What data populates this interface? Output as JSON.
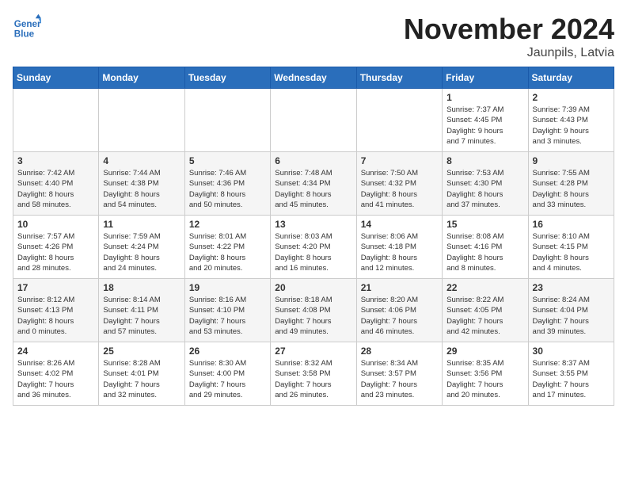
{
  "logo": {
    "line1": "General",
    "line2": "Blue"
  },
  "title": "November 2024",
  "subtitle": "Jaunpils, Latvia",
  "days_header": [
    "Sunday",
    "Monday",
    "Tuesday",
    "Wednesday",
    "Thursday",
    "Friday",
    "Saturday"
  ],
  "weeks": [
    [
      {
        "day": "",
        "info": ""
      },
      {
        "day": "",
        "info": ""
      },
      {
        "day": "",
        "info": ""
      },
      {
        "day": "",
        "info": ""
      },
      {
        "day": "",
        "info": ""
      },
      {
        "day": "1",
        "info": "Sunrise: 7:37 AM\nSunset: 4:45 PM\nDaylight: 9 hours\nand 7 minutes."
      },
      {
        "day": "2",
        "info": "Sunrise: 7:39 AM\nSunset: 4:43 PM\nDaylight: 9 hours\nand 3 minutes."
      }
    ],
    [
      {
        "day": "3",
        "info": "Sunrise: 7:42 AM\nSunset: 4:40 PM\nDaylight: 8 hours\nand 58 minutes."
      },
      {
        "day": "4",
        "info": "Sunrise: 7:44 AM\nSunset: 4:38 PM\nDaylight: 8 hours\nand 54 minutes."
      },
      {
        "day": "5",
        "info": "Sunrise: 7:46 AM\nSunset: 4:36 PM\nDaylight: 8 hours\nand 50 minutes."
      },
      {
        "day": "6",
        "info": "Sunrise: 7:48 AM\nSunset: 4:34 PM\nDaylight: 8 hours\nand 45 minutes."
      },
      {
        "day": "7",
        "info": "Sunrise: 7:50 AM\nSunset: 4:32 PM\nDaylight: 8 hours\nand 41 minutes."
      },
      {
        "day": "8",
        "info": "Sunrise: 7:53 AM\nSunset: 4:30 PM\nDaylight: 8 hours\nand 37 minutes."
      },
      {
        "day": "9",
        "info": "Sunrise: 7:55 AM\nSunset: 4:28 PM\nDaylight: 8 hours\nand 33 minutes."
      }
    ],
    [
      {
        "day": "10",
        "info": "Sunrise: 7:57 AM\nSunset: 4:26 PM\nDaylight: 8 hours\nand 28 minutes."
      },
      {
        "day": "11",
        "info": "Sunrise: 7:59 AM\nSunset: 4:24 PM\nDaylight: 8 hours\nand 24 minutes."
      },
      {
        "day": "12",
        "info": "Sunrise: 8:01 AM\nSunset: 4:22 PM\nDaylight: 8 hours\nand 20 minutes."
      },
      {
        "day": "13",
        "info": "Sunrise: 8:03 AM\nSunset: 4:20 PM\nDaylight: 8 hours\nand 16 minutes."
      },
      {
        "day": "14",
        "info": "Sunrise: 8:06 AM\nSunset: 4:18 PM\nDaylight: 8 hours\nand 12 minutes."
      },
      {
        "day": "15",
        "info": "Sunrise: 8:08 AM\nSunset: 4:16 PM\nDaylight: 8 hours\nand 8 minutes."
      },
      {
        "day": "16",
        "info": "Sunrise: 8:10 AM\nSunset: 4:15 PM\nDaylight: 8 hours\nand 4 minutes."
      }
    ],
    [
      {
        "day": "17",
        "info": "Sunrise: 8:12 AM\nSunset: 4:13 PM\nDaylight: 8 hours\nand 0 minutes."
      },
      {
        "day": "18",
        "info": "Sunrise: 8:14 AM\nSunset: 4:11 PM\nDaylight: 7 hours\nand 57 minutes."
      },
      {
        "day": "19",
        "info": "Sunrise: 8:16 AM\nSunset: 4:10 PM\nDaylight: 7 hours\nand 53 minutes."
      },
      {
        "day": "20",
        "info": "Sunrise: 8:18 AM\nSunset: 4:08 PM\nDaylight: 7 hours\nand 49 minutes."
      },
      {
        "day": "21",
        "info": "Sunrise: 8:20 AM\nSunset: 4:06 PM\nDaylight: 7 hours\nand 46 minutes."
      },
      {
        "day": "22",
        "info": "Sunrise: 8:22 AM\nSunset: 4:05 PM\nDaylight: 7 hours\nand 42 minutes."
      },
      {
        "day": "23",
        "info": "Sunrise: 8:24 AM\nSunset: 4:04 PM\nDaylight: 7 hours\nand 39 minutes."
      }
    ],
    [
      {
        "day": "24",
        "info": "Sunrise: 8:26 AM\nSunset: 4:02 PM\nDaylight: 7 hours\nand 36 minutes."
      },
      {
        "day": "25",
        "info": "Sunrise: 8:28 AM\nSunset: 4:01 PM\nDaylight: 7 hours\nand 32 minutes."
      },
      {
        "day": "26",
        "info": "Sunrise: 8:30 AM\nSunset: 4:00 PM\nDaylight: 7 hours\nand 29 minutes."
      },
      {
        "day": "27",
        "info": "Sunrise: 8:32 AM\nSunset: 3:58 PM\nDaylight: 7 hours\nand 26 minutes."
      },
      {
        "day": "28",
        "info": "Sunrise: 8:34 AM\nSunset: 3:57 PM\nDaylight: 7 hours\nand 23 minutes."
      },
      {
        "day": "29",
        "info": "Sunrise: 8:35 AM\nSunset: 3:56 PM\nDaylight: 7 hours\nand 20 minutes."
      },
      {
        "day": "30",
        "info": "Sunrise: 8:37 AM\nSunset: 3:55 PM\nDaylight: 7 hours\nand 17 minutes."
      }
    ]
  ]
}
